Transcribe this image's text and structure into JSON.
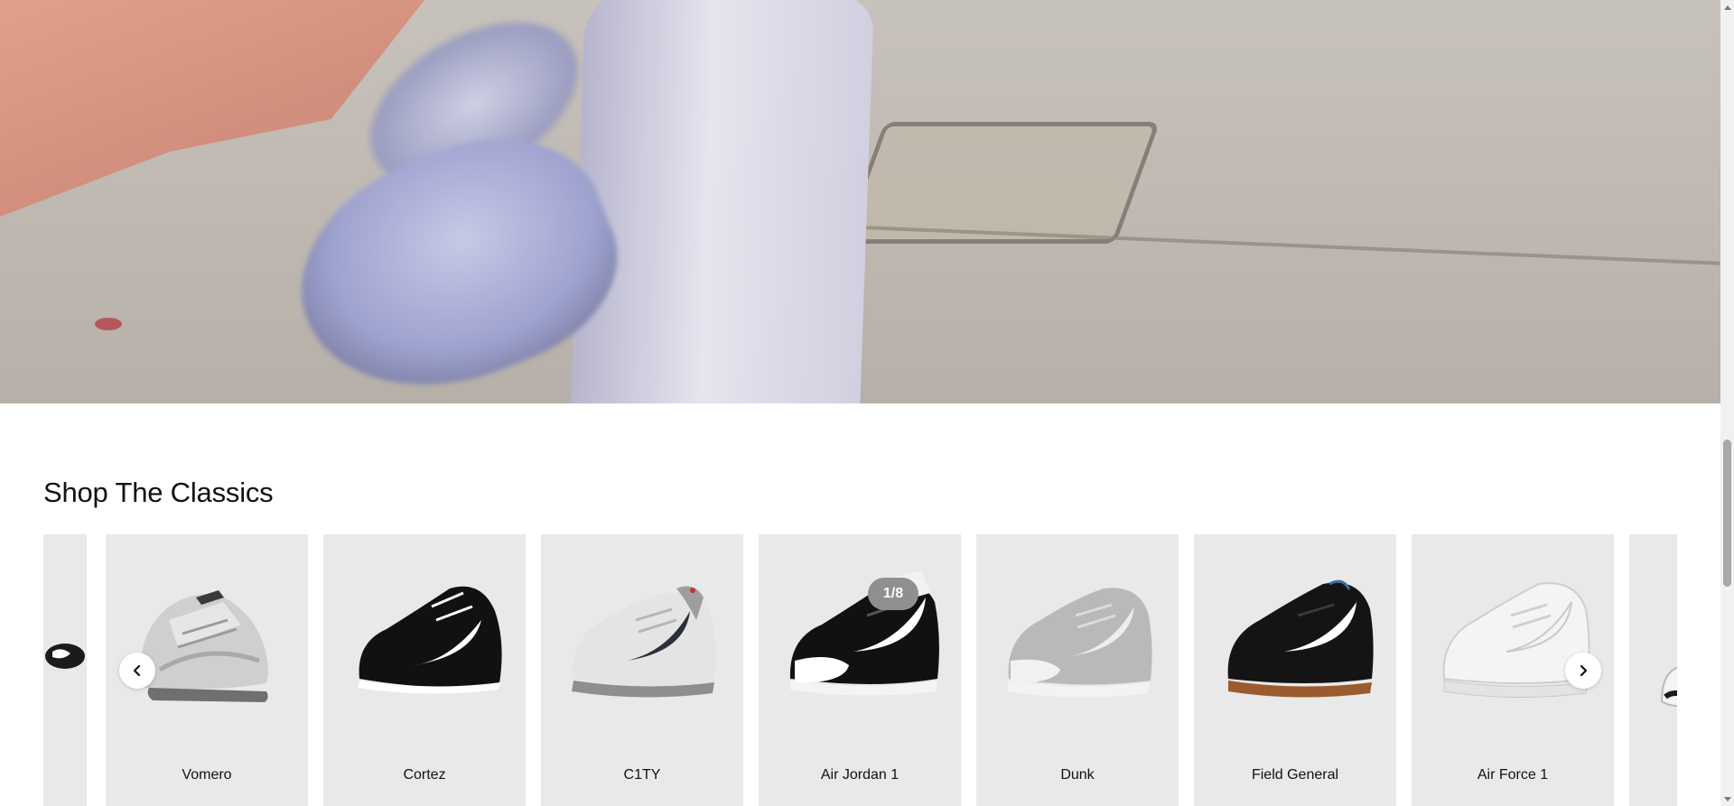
{
  "hero": {
    "alt_subject": "motion-blurred grey sneakers on pavement"
  },
  "section": {
    "title": "Shop The Classics"
  },
  "carousel": {
    "items": [
      {
        "label": "",
        "style": "partial-left"
      },
      {
        "label": "Vomero",
        "style": "silver-runner"
      },
      {
        "label": "Cortez",
        "style": "black-white"
      },
      {
        "label": "C1TY",
        "style": "grey-white"
      },
      {
        "label": "Air Jordan 1",
        "style": "panda"
      },
      {
        "label": "Dunk",
        "style": "grey-white-low"
      },
      {
        "label": "Field General",
        "style": "black-gum"
      },
      {
        "label": "Air Force 1",
        "style": "all-white"
      },
      {
        "label": "",
        "style": "partial-right"
      }
    ],
    "badge": "1/8",
    "prev_icon": "chevron-left-icon",
    "next_icon": "chevron-right-icon"
  },
  "colors": {
    "card_bg": "#e9e9e9",
    "badge_bg": "#8f8f8f",
    "text": "#111111"
  }
}
